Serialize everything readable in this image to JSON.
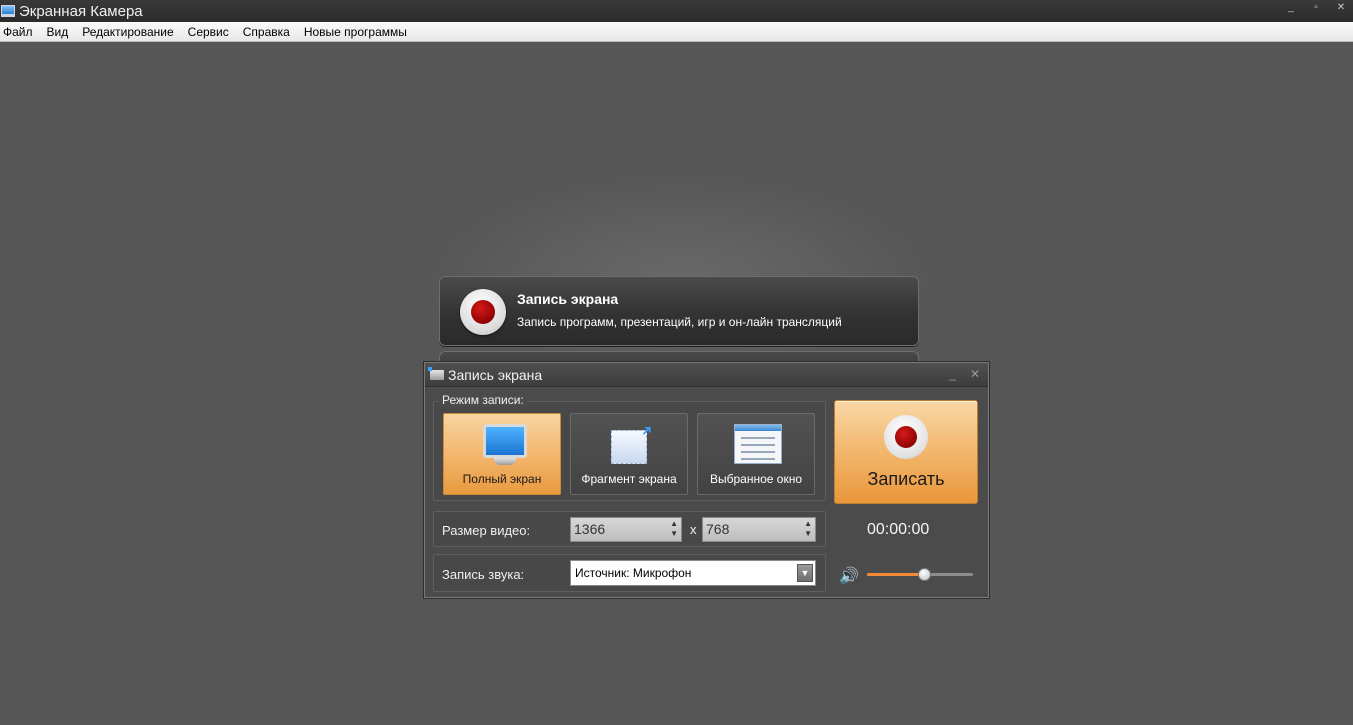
{
  "window": {
    "title": "Экранная Камера",
    "controls": {
      "minimize": "_",
      "restore": "▫",
      "close": "✕"
    }
  },
  "menu": [
    "Файл",
    "Вид",
    "Редактирование",
    "Сервис",
    "Справка",
    "Новые программы"
  ],
  "card": {
    "title": "Запись экрана",
    "subtitle": "Запись программ, презентаций, игр и он-лайн трансляций"
  },
  "dialog": {
    "title": "Запись экрана",
    "controls": {
      "minimize": "_",
      "close": "✕"
    },
    "mode_legend": "Режим записи:",
    "modes": [
      {
        "label": "Полный экран",
        "active": true,
        "icon": "monitor-icon"
      },
      {
        "label": "Фрагмент экрана",
        "active": false,
        "icon": "fragment-icon"
      },
      {
        "label": "Выбранное окно",
        "active": false,
        "icon": "window-icon"
      }
    ],
    "record_label": "Записать",
    "video_size_label": "Размер видео:",
    "width": "1366",
    "height": "768",
    "times": "x",
    "audio_label": "Запись звука:",
    "audio_source": "Источник: Микрофон",
    "timer": "00:00:00",
    "volume_fraction": 0.55,
    "accent_color": "#f28a3a"
  }
}
